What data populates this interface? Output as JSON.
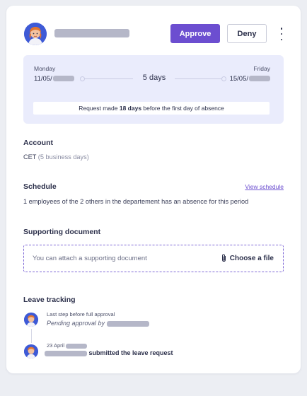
{
  "header": {
    "approve_label": "Approve",
    "deny_label": "Deny",
    "avatar_icon": "user-avatar"
  },
  "absence": {
    "start_day": "Monday",
    "start_date": "11/05/",
    "end_day": "Friday",
    "end_date": "15/05/",
    "duration": "5 days",
    "request_note_prefix": "Request made ",
    "request_note_days": "18 days",
    "request_note_suffix": " before the first day of absence"
  },
  "account": {
    "title": "Account",
    "value": "CET",
    "detail": "(5 business days)"
  },
  "schedule": {
    "title": "Schedule",
    "link": "View schedule",
    "text": "1 employees of the 2 others in the departement has an absence for this period"
  },
  "document": {
    "title": "Supporting document",
    "placeholder": "You can attach a supporting document",
    "choose_label": "Choose a file",
    "icon": "paperclip-icon"
  },
  "tracking": {
    "title": "Leave tracking",
    "step1_caption": "Last step before full approval",
    "step1_status": "Pending approval by",
    "step2_date": "23 April",
    "step2_action": "submitted the leave request"
  },
  "colors": {
    "accent": "#6c4ed0",
    "panel": "#eaecfc",
    "redaction": "#b5b7c8"
  }
}
